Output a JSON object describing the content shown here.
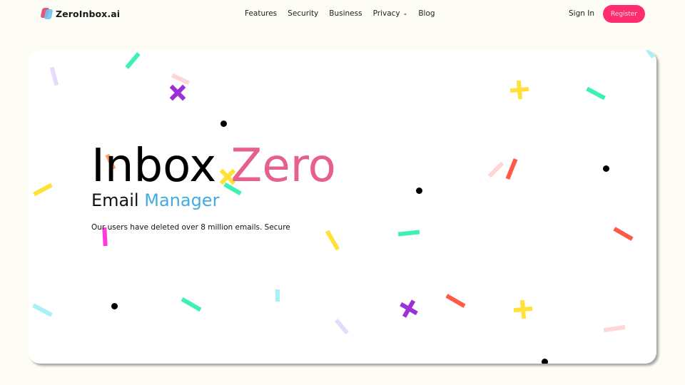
{
  "nav": {
    "brand": "ZeroInbox.ai",
    "links": [
      "Features",
      "Security",
      "Business",
      "Privacy",
      "Blog"
    ],
    "privacy_has_dropdown": true,
    "sign_in": "Sign In",
    "register": "Register"
  },
  "hero": {
    "title_part1": "Inbox",
    "title_part2": "Zero",
    "subtitle_part1": "Email",
    "subtitle_part2": "Manager",
    "description": "Our users have deleted over 8 million emails. Secure"
  },
  "colors": {
    "background": "#fdfcf5",
    "card": "#ffffff",
    "accent_pink": "#ff2d6f",
    "title_zero": "#e5608d",
    "subtitle_manager": "#42ace2"
  }
}
